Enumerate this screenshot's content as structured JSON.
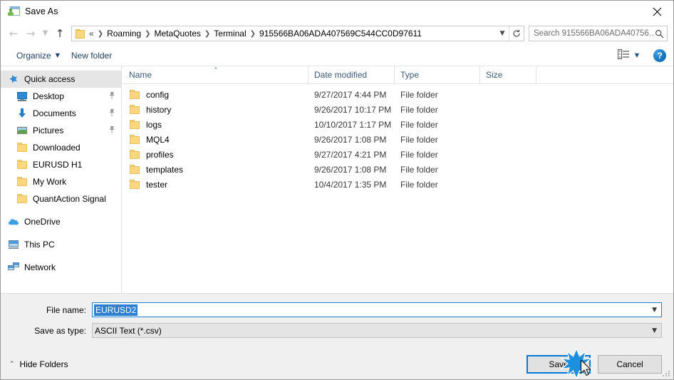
{
  "window": {
    "title": "Save As",
    "icon": "save-as-app-icon",
    "close_label": "✕"
  },
  "nav": {
    "back_icon": "arrow-left-icon",
    "forward_icon": "arrow-right-icon",
    "recent_icon": "chevron-down-icon",
    "up_icon": "arrow-up-icon",
    "refresh_icon": "refresh-icon",
    "address": {
      "folder_icon": "folder-icon",
      "lead": "«",
      "crumbs": [
        "Roaming",
        "MetaQuotes",
        "Terminal",
        "915566BA06ADA407569C544CC0D97611"
      ],
      "separator": "❯",
      "dropdown_icon": "chevron-down-icon"
    },
    "search": {
      "placeholder": "Search 915566BA06ADA40756…",
      "icon": "search-icon"
    }
  },
  "toolbar": {
    "organize_label": "Organize",
    "organize_caret": "▼",
    "new_folder_label": "New folder",
    "view_icon": "list-view-icon",
    "view_caret": "▼",
    "help_label": "?"
  },
  "sidebar": {
    "items": [
      {
        "label": "Quick access",
        "icon": "star-icon",
        "selected": true,
        "pinned": false,
        "indent": "root"
      },
      {
        "label": "Desktop",
        "icon": "monitor-icon",
        "selected": false,
        "pinned": true,
        "indent": "child"
      },
      {
        "label": "Documents",
        "icon": "download-arrow-icon",
        "selected": false,
        "pinned": true,
        "indent": "child"
      },
      {
        "label": "Pictures",
        "icon": "picture-icon",
        "selected": false,
        "pinned": true,
        "indent": "child"
      },
      {
        "label": "Downloaded",
        "icon": "folder-icon",
        "selected": false,
        "pinned": false,
        "indent": "child"
      },
      {
        "label": "EURUSD H1",
        "icon": "folder-icon",
        "selected": false,
        "pinned": false,
        "indent": "child"
      },
      {
        "label": "My Work",
        "icon": "folder-icon",
        "selected": false,
        "pinned": false,
        "indent": "child"
      },
      {
        "label": "QuantAction Signal",
        "icon": "folder-icon",
        "selected": false,
        "pinned": false,
        "indent": "child"
      },
      {
        "label": "OneDrive",
        "icon": "cloud-icon",
        "selected": false,
        "pinned": false,
        "indent": "root",
        "gap_before": true
      },
      {
        "label": "This PC",
        "icon": "computer-icon",
        "selected": false,
        "pinned": false,
        "indent": "root",
        "gap_before": true
      },
      {
        "label": "Network",
        "icon": "network-icon",
        "selected": false,
        "pinned": false,
        "indent": "root",
        "gap_before": true
      }
    ]
  },
  "filelist": {
    "columns": [
      {
        "label": "Name",
        "sorted": "asc",
        "sort_caret": "⌃"
      },
      {
        "label": "Date modified",
        "sorted": ""
      },
      {
        "label": "Type",
        "sorted": ""
      },
      {
        "label": "Size",
        "sorted": ""
      }
    ],
    "rows": [
      {
        "name": "config",
        "date": "9/27/2017 4:44 PM",
        "type": "File folder",
        "size": "",
        "icon": "folder-icon"
      },
      {
        "name": "history",
        "date": "9/26/2017 10:17 PM",
        "type": "File folder",
        "size": "",
        "icon": "folder-icon"
      },
      {
        "name": "logs",
        "date": "10/10/2017 1:17 PM",
        "type": "File folder",
        "size": "",
        "icon": "folder-icon"
      },
      {
        "name": "MQL4",
        "date": "9/26/2017 1:08 PM",
        "type": "File folder",
        "size": "",
        "icon": "folder-icon"
      },
      {
        "name": "profiles",
        "date": "9/27/2017 4:21 PM",
        "type": "File folder",
        "size": "",
        "icon": "folder-icon"
      },
      {
        "name": "templates",
        "date": "9/26/2017 1:08 PM",
        "type": "File folder",
        "size": "",
        "icon": "folder-icon"
      },
      {
        "name": "tester",
        "date": "10/4/2017 1:35 PM",
        "type": "File folder",
        "size": "",
        "icon": "folder-icon"
      }
    ]
  },
  "form": {
    "filename_label": "File name:",
    "filename_value": "EURUSD2",
    "filetype_label": "Save as type:",
    "filetype_value": "ASCII Text (*.csv)",
    "dropdown_icon": "chevron-down-icon"
  },
  "footer": {
    "hide_folders_label": "Hide Folders",
    "hide_folders_caret": "⌃",
    "save_label": "Save",
    "cancel_label": "Cancel",
    "resize_grip": "resize-grip-icon"
  },
  "colors": {
    "accent": "#0078d7",
    "selection": "#2f7fd0",
    "folder": "#fcd77d",
    "sidebar_selected": "#e5e5e5",
    "column_header_text": "#3b5a77",
    "dialog_chrome": "#f0f0f0"
  }
}
